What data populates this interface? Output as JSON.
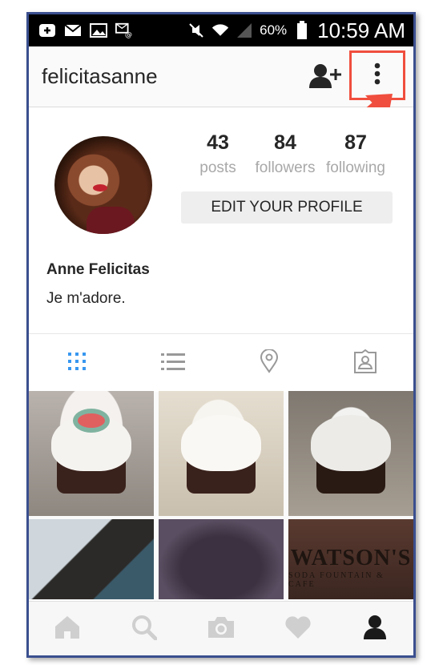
{
  "status_bar": {
    "battery_percent": "60%",
    "time": "10:59 AM",
    "icons": [
      "add-notification-icon",
      "mail-icon",
      "image-icon",
      "email-alert-icon",
      "mute-icon",
      "wifi-icon",
      "signal-icon",
      "battery-icon"
    ]
  },
  "header": {
    "username": "felicitasanne",
    "actions": [
      "add-user-icon",
      "more-vertical-icon"
    ]
  },
  "profile": {
    "stats": [
      {
        "value": "43",
        "label": "posts"
      },
      {
        "value": "84",
        "label": "followers"
      },
      {
        "value": "87",
        "label": "following"
      }
    ],
    "edit_button": "EDIT YOUR PROFILE",
    "full_name": "Anne Felicitas",
    "bio": "Je m'adore."
  },
  "tabs": [
    "grid-icon",
    "list-icon",
    "location-pin-icon",
    "tagged-photos-icon"
  ],
  "grid": {
    "photo_text": {
      "title": "WATSON'S",
      "subtitle": "SODA FOUNTAIN & CAFE"
    }
  },
  "bottom_nav": [
    "home-icon",
    "search-icon",
    "camera-icon",
    "heart-icon",
    "profile-icon"
  ],
  "colors": {
    "highlight": "#f04e3e",
    "tab_active": "#3897f0",
    "frame": "#3b4f8f"
  }
}
